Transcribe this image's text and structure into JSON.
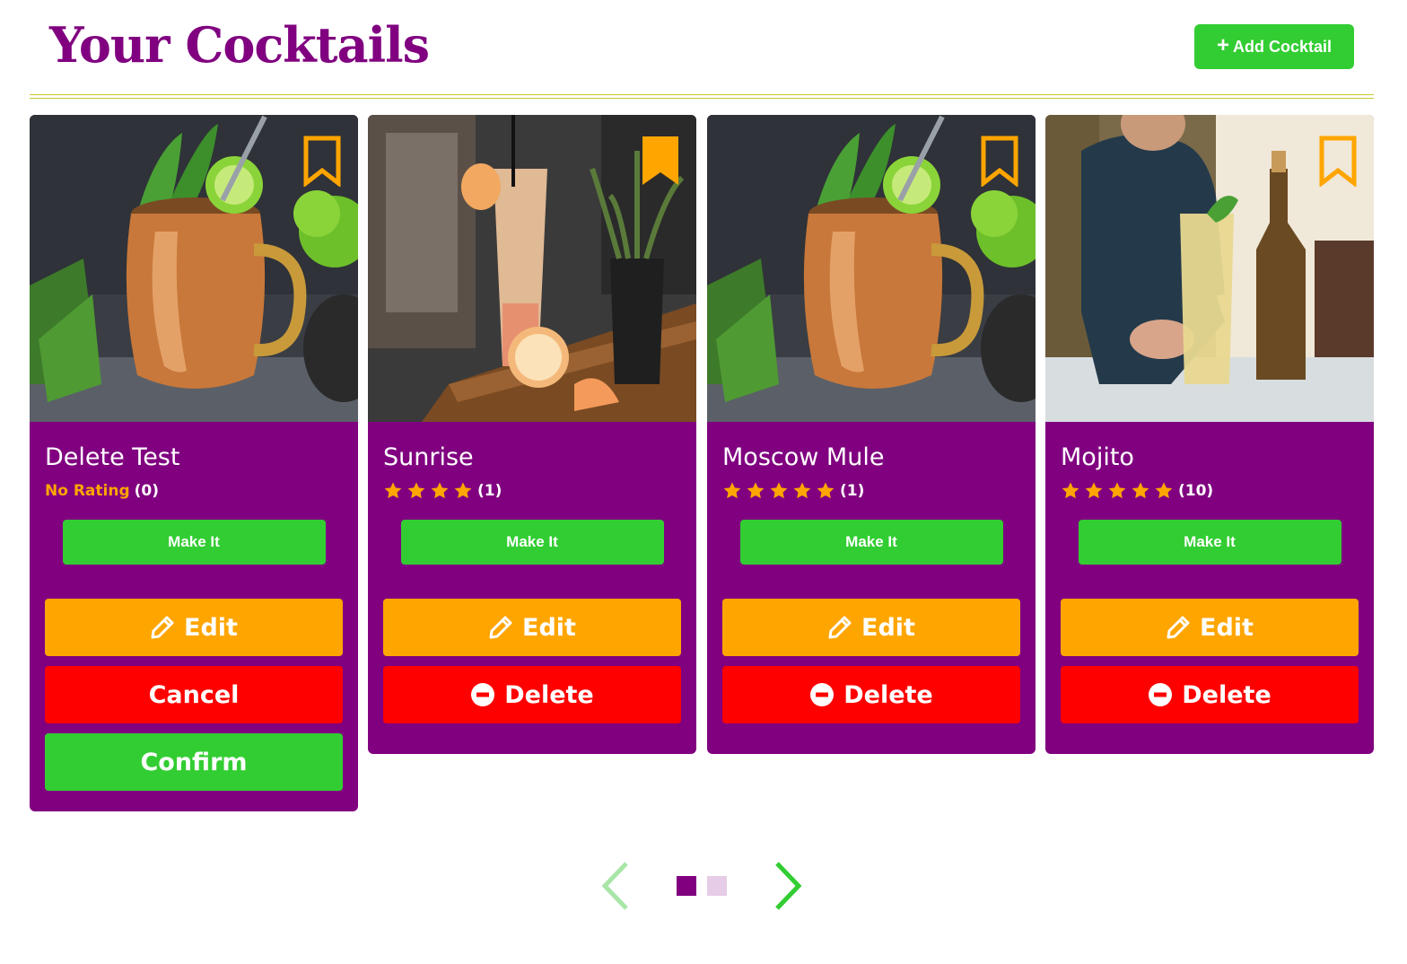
{
  "header": {
    "title": "Your Cocktails",
    "add_button_label": "Add Cocktail",
    "add_icon": "plus-icon"
  },
  "cards": [
    {
      "name": "Delete Test",
      "rating_label": "No Rating",
      "stars": 0,
      "rating_count": "(0)",
      "bookmarked": false,
      "image": "copper mug mule with lime and mint",
      "make_it_label": "Make It",
      "edit_label": "Edit",
      "cancel_label": "Cancel",
      "confirm_label": "Confirm"
    },
    {
      "name": "Sunrise",
      "stars": 4,
      "rating_count": "(1)",
      "bookmarked": true,
      "image": "orange sunrise cocktail on bar with grapefruit",
      "make_it_label": "Make It",
      "edit_label": "Edit",
      "delete_label": "Delete"
    },
    {
      "name": "Moscow Mule",
      "stars": 5,
      "rating_count": "(1)",
      "bookmarked": false,
      "image": "copper mug mule with lime and mint",
      "make_it_label": "Make It",
      "edit_label": "Edit",
      "delete_label": "Delete"
    },
    {
      "name": "Mojito",
      "stars": 5,
      "rating_count": "(10)",
      "bookmarked": false,
      "image": "bartender serving mojito",
      "make_it_label": "Make It",
      "edit_label": "Edit",
      "delete_label": "Delete"
    }
  ],
  "pager": {
    "pages": 2,
    "current_page": 1,
    "prev_icon": "chevron-left-icon",
    "next_icon": "chevron-right-icon"
  },
  "colors": {
    "brand_purple": "#800080",
    "green": "#32cd32",
    "orange": "#ffa500",
    "red": "#ff0000",
    "rule": "#c8c832"
  }
}
